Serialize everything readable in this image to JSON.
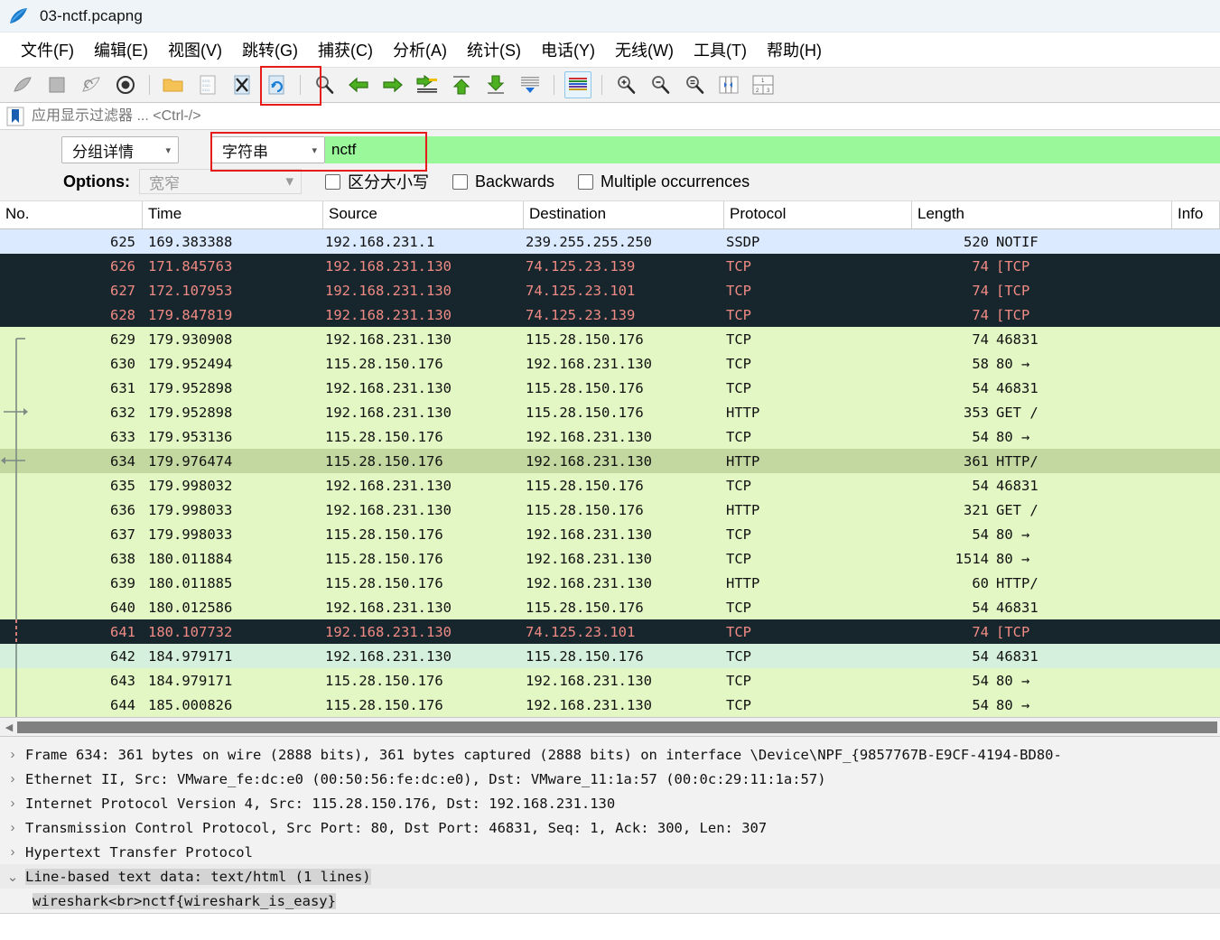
{
  "window": {
    "title": "03-nctf.pcapng",
    "logo_icon": "wireshark-shark-fin-icon"
  },
  "menu": {
    "items": [
      {
        "label": "文件(F)",
        "name": "menu-file"
      },
      {
        "label": "编辑(E)",
        "name": "menu-edit"
      },
      {
        "label": "视图(V)",
        "name": "menu-view"
      },
      {
        "label": "跳转(G)",
        "name": "menu-go"
      },
      {
        "label": "捕获(C)",
        "name": "menu-capture"
      },
      {
        "label": "分析(A)",
        "name": "menu-analyze"
      },
      {
        "label": "统计(S)",
        "name": "menu-statistics"
      },
      {
        "label": "电话(Y)",
        "name": "menu-telephony"
      },
      {
        "label": "无线(W)",
        "name": "menu-wireless"
      },
      {
        "label": "工具(T)",
        "name": "menu-tools"
      },
      {
        "label": "帮助(H)",
        "name": "menu-help"
      }
    ]
  },
  "toolbar": {
    "icons": [
      "start-capture-icon",
      "stop-capture-icon",
      "restart-capture-icon",
      "capture-options-icon",
      "open-file-icon",
      "save-file-icon",
      "close-file-icon",
      "reload-file-icon",
      "find-packet-icon",
      "go-back-icon",
      "go-forward-icon",
      "go-to-packet-icon",
      "go-to-first-packet-icon",
      "go-to-last-packet-icon",
      "auto-scroll-icon",
      "colorize-packets-icon",
      "zoom-in-icon",
      "zoom-out-icon",
      "zoom-reset-icon",
      "resize-columns-icon",
      "layout-icon"
    ],
    "annotation_color": "#e81b1b"
  },
  "display_filter": {
    "placeholder": "应用显示过滤器 ... <Ctrl-/>",
    "value": "",
    "bookmark_icon": "bookmark-icon"
  },
  "find": {
    "search_in": "分组详情",
    "search_type": "字符串",
    "search_value": "nctf",
    "search_value_bg": "#9af79a",
    "options_label": "Options:",
    "char_width": "宽窄",
    "checkboxes": [
      {
        "label": "区分大小写",
        "checked": false,
        "name": "case-sensitive-checkbox"
      },
      {
        "label": "Backwards",
        "checked": false,
        "name": "backwards-checkbox"
      },
      {
        "label": "Multiple occurrences",
        "checked": false,
        "name": "multiple-occurrences-checkbox"
      }
    ]
  },
  "packet_list": {
    "columns": [
      "No.",
      "Time",
      "Source",
      "Destination",
      "Protocol",
      "Length",
      "Info"
    ],
    "rows": [
      {
        "no": "625",
        "time": "169.383388",
        "src": "192.168.231.1",
        "dst": "239.255.255.250",
        "proto": "SSDP",
        "len": "520",
        "info": "NOTIF",
        "style": "r-selected-blue",
        "marker": ""
      },
      {
        "no": "626",
        "time": "171.845763",
        "src": "192.168.231.130",
        "dst": "74.125.23.139",
        "proto": "TCP",
        "len": "74",
        "info": "[TCP",
        "style": "r-black",
        "marker": ""
      },
      {
        "no": "627",
        "time": "172.107953",
        "src": "192.168.231.130",
        "dst": "74.125.23.101",
        "proto": "TCP",
        "len": "74",
        "info": "[TCP",
        "style": "r-black",
        "marker": ""
      },
      {
        "no": "628",
        "time": "179.847819",
        "src": "192.168.231.130",
        "dst": "74.125.23.139",
        "proto": "TCP",
        "len": "74",
        "info": "[TCP",
        "style": "r-black",
        "marker": ""
      },
      {
        "no": "629",
        "time": "179.930908",
        "src": "192.168.231.130",
        "dst": "115.28.150.176",
        "proto": "TCP",
        "len": "74",
        "info": "46831",
        "style": "r-green",
        "marker": "top"
      },
      {
        "no": "630",
        "time": "179.952494",
        "src": "115.28.150.176",
        "dst": "192.168.231.130",
        "proto": "TCP",
        "len": "58",
        "info": "80 →",
        "style": "r-green",
        "marker": "line"
      },
      {
        "no": "631",
        "time": "179.952898",
        "src": "192.168.231.130",
        "dst": "115.28.150.176",
        "proto": "TCP",
        "len": "54",
        "info": "46831",
        "style": "r-green",
        "marker": "line"
      },
      {
        "no": "632",
        "time": "179.952898",
        "src": "192.168.231.130",
        "dst": "115.28.150.176",
        "proto": "HTTP",
        "len": "353",
        "info": "GET /",
        "style": "r-green",
        "marker": "request"
      },
      {
        "no": "633",
        "time": "179.953136",
        "src": "115.28.150.176",
        "dst": "192.168.231.130",
        "proto": "TCP",
        "len": "54",
        "info": "80 →",
        "style": "r-green",
        "marker": "line"
      },
      {
        "no": "634",
        "time": "179.976474",
        "src": "115.28.150.176",
        "dst": "192.168.231.130",
        "proto": "HTTP",
        "len": "361",
        "info": "HTTP/",
        "style": "r-greensel",
        "marker": "response"
      },
      {
        "no": "635",
        "time": "179.998032",
        "src": "192.168.231.130",
        "dst": "115.28.150.176",
        "proto": "TCP",
        "len": "54",
        "info": "46831",
        "style": "r-green",
        "marker": "line"
      },
      {
        "no": "636",
        "time": "179.998033",
        "src": "192.168.231.130",
        "dst": "115.28.150.176",
        "proto": "HTTP",
        "len": "321",
        "info": "GET /",
        "style": "r-green",
        "marker": "line"
      },
      {
        "no": "637",
        "time": "179.998033",
        "src": "115.28.150.176",
        "dst": "192.168.231.130",
        "proto": "TCP",
        "len": "54",
        "info": "80 →",
        "style": "r-green",
        "marker": "line"
      },
      {
        "no": "638",
        "time": "180.011884",
        "src": "115.28.150.176",
        "dst": "192.168.231.130",
        "proto": "TCP",
        "len": "1514",
        "info": "80 →",
        "style": "r-green",
        "marker": "line"
      },
      {
        "no": "639",
        "time": "180.011885",
        "src": "115.28.150.176",
        "dst": "192.168.231.130",
        "proto": "HTTP",
        "len": "60",
        "info": "HTTP/",
        "style": "r-green",
        "marker": "line"
      },
      {
        "no": "640",
        "time": "180.012586",
        "src": "192.168.231.130",
        "dst": "115.28.150.176",
        "proto": "TCP",
        "len": "54",
        "info": "46831",
        "style": "r-green",
        "marker": "line"
      },
      {
        "no": "641",
        "time": "180.107732",
        "src": "192.168.231.130",
        "dst": "74.125.23.101",
        "proto": "TCP",
        "len": "74",
        "info": "[TCP",
        "style": "r-black",
        "marker": "dash"
      },
      {
        "no": "642",
        "time": "184.979171",
        "src": "192.168.231.130",
        "dst": "115.28.150.176",
        "proto": "TCP",
        "len": "54",
        "info": "46831",
        "style": "r-greenlt",
        "marker": "line"
      },
      {
        "no": "643",
        "time": "184.979171",
        "src": "115.28.150.176",
        "dst": "192.168.231.130",
        "proto": "TCP",
        "len": "54",
        "info": "80 →",
        "style": "r-green",
        "marker": "line"
      },
      {
        "no": "644",
        "time": "185.000826",
        "src": "115.28.150.176",
        "dst": "192.168.231.130",
        "proto": "TCP",
        "len": "54",
        "info": "80 →",
        "style": "r-green",
        "marker": "line"
      }
    ]
  },
  "detail": {
    "rows": [
      {
        "twist": "collapsed",
        "text": "Frame 634: 361 bytes on wire (2888 bits), 361 bytes captured (2888 bits) on interface \\Device\\NPF_{9857767B-E9CF-4194-BD80-",
        "name": "detail-frame"
      },
      {
        "twist": "collapsed",
        "text": "Ethernet II, Src: VMware_fe:dc:e0 (00:50:56:fe:dc:e0), Dst: VMware_11:1a:57 (00:0c:29:11:1a:57)",
        "name": "detail-ethernet"
      },
      {
        "twist": "collapsed",
        "text": "Internet Protocol Version 4, Src: 115.28.150.176, Dst: 192.168.231.130",
        "name": "detail-ipv4"
      },
      {
        "twist": "collapsed",
        "text": "Transmission Control Protocol, Src Port: 80, Dst Port: 46831, Seq: 1, Ack: 300, Len: 307",
        "name": "detail-tcp"
      },
      {
        "twist": "collapsed",
        "text": "Hypertext Transfer Protocol",
        "name": "detail-http"
      },
      {
        "twist": "expanded",
        "text": "Line-based text data: text/html (1 lines)",
        "name": "detail-line-based-text-data"
      }
    ],
    "highlighted_value": "wireshark<br>nctf{wireshark_is_easy}"
  }
}
